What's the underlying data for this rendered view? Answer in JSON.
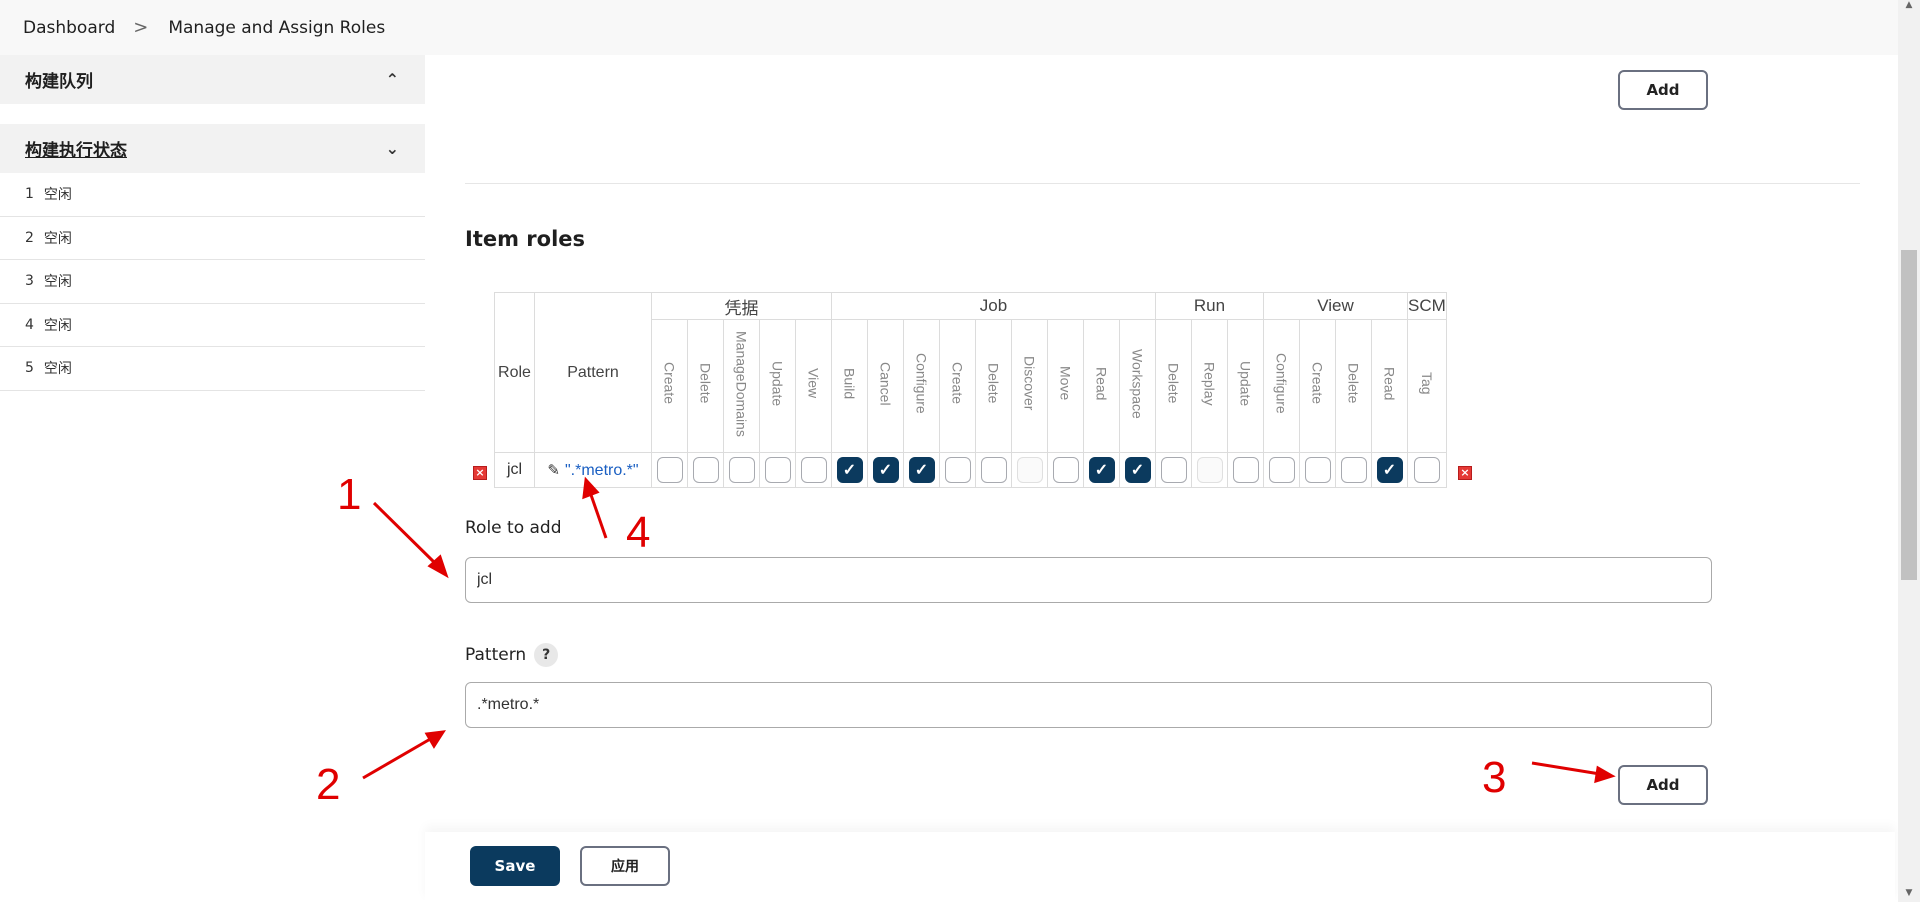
{
  "breadcrumb": {
    "items": [
      "Dashboard",
      "Manage and Assign Roles"
    ],
    "separator": ">"
  },
  "sidebar": {
    "queue_title": "构建队列",
    "exec_title": "构建执行状态",
    "executors": [
      {
        "num": "1",
        "status": "空闲"
      },
      {
        "num": "2",
        "status": "空闲"
      },
      {
        "num": "3",
        "status": "空闲"
      },
      {
        "num": "4",
        "status": "空闲"
      },
      {
        "num": "5",
        "status": "空闲"
      }
    ]
  },
  "main": {
    "top_add_label": "Add",
    "item_roles_title": "Item roles",
    "table": {
      "role_header": "Role",
      "pattern_header": "Pattern",
      "groups": [
        {
          "name": "凭据",
          "perms": [
            "Create",
            "Delete",
            "ManageDomains",
            "Update",
            "View"
          ]
        },
        {
          "name": "Job",
          "perms": [
            "Build",
            "Cancel",
            "Configure",
            "Create",
            "Delete",
            "Discover",
            "Move",
            "Read",
            "Workspace"
          ]
        },
        {
          "name": "Run",
          "perms": [
            "Delete",
            "Replay",
            "Update"
          ]
        },
        {
          "name": "View",
          "perms": [
            "Configure",
            "Create",
            "Delete",
            "Read"
          ]
        },
        {
          "name": "SCM",
          "perms": [
            "Tag"
          ]
        }
      ],
      "rows": [
        {
          "role": "jcl",
          "pattern": "\".*metro.*\"",
          "checks": [
            "off",
            "off",
            "off",
            "off",
            "off",
            "on",
            "on",
            "on",
            "off",
            "off",
            "dis",
            "off",
            "on",
            "on",
            "off",
            "dis",
            "off",
            "off",
            "off",
            "off",
            "on",
            "off"
          ]
        }
      ]
    },
    "role_to_add_label": "Role to add",
    "role_to_add_value": "jcl",
    "pattern_label": "Pattern",
    "pattern_help": "?",
    "pattern_value": ".*metro.*",
    "add_label": "Add"
  },
  "bottom": {
    "save_label": "Save",
    "apply_label": "应用"
  },
  "annotations": [
    "1",
    "2",
    "3",
    "4"
  ],
  "colors": {
    "primary": "#0b3a5e",
    "annotation": "#e00000",
    "link": "#1a5fc2"
  }
}
